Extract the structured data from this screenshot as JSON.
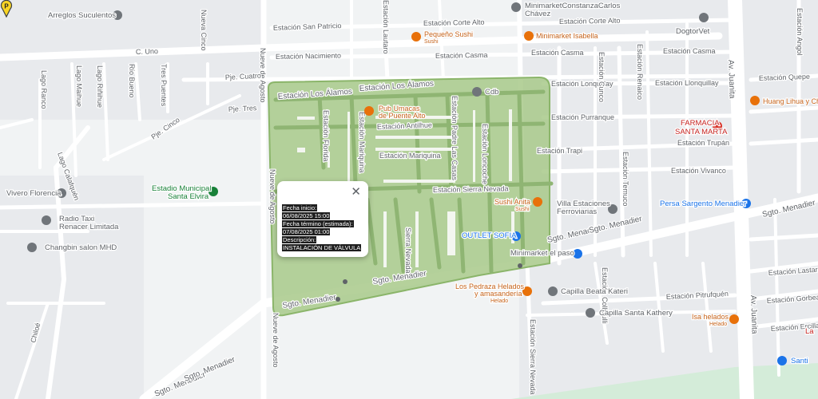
{
  "popup": {
    "fecha_inicio_label": "Fecha inicio:",
    "fecha_inicio_value": "06/08/2025 15:00",
    "fecha_termino_label": "Fecha término (estimada):",
    "fecha_termino_value": "07/08/2025 01:00",
    "descripcion_label": "Descripción:",
    "descripcion_value": "INSTALACIÓN DE VÁLVULA",
    "close_symbol": "✕"
  },
  "marker": {
    "letter": "P",
    "color": "#f9d423"
  },
  "area": {
    "fill": "#a8c98a",
    "stroke": "#8bb56a"
  },
  "streets": {
    "corte_alto_1": "Estación Corte Alto",
    "corte_alto_2": "Estación Corte Alto",
    "san_patricio": "Estación San Patricio",
    "c_uno": "C. Uno",
    "nacimiento": "Estación Nacimiento",
    "casma_1": "Estación Casma",
    "casma_2": "Estación Casma",
    "casma_3": "Estación Casma",
    "los_alamos_1": "Estación Los Álamos",
    "los_alamos_2": "Estación Los Álamos",
    "lonquillay_1": "Estación Lonquillay",
    "lonquillay_2": "Estación Llonquillay",
    "quepe": "Estación Quepe",
    "purranque": "Estación Purranque",
    "antilhue": "Estación Antilhue",
    "trapi": "Estación Trapi",
    "trupan": "Estación Trupán",
    "vivanco": "Estación Vivanco",
    "mariquina": "Estación Mariquina",
    "sierra_nevada": "Estación Sierra Nevada",
    "sgto_menadier_1": "Sgto. Menadier",
    "sgto_menadier_2": "Sgto. Menadier",
    "sgto_menadier_3": "Sgto. Menadier",
    "sgto_menadier_4": "Sgto. Menadier",
    "sgto_menadier_5": "Sgto. Menadier",
    "sgto_menadier_6": "Sgto. Menadier",
    "sgto_menadier_7": "Sgto. Menadier",
    "pitrufquen": "Estación Pitrufquén",
    "gorbea": "Estación Gorbea",
    "lastarria": "Estación Lastarria",
    "ercilla": "Estación Ercilla",
    "av_juanita_1": "Av. Juanita",
    "av_juanita_2": "Av. Juanita",
    "nueve_agosto_1": "Nueve de Agosto",
    "nueve_agosto_2": "Nueve de Agosto",
    "nueve_agosto_3": "Nueve de Agosto",
    "chiloe": "Chiloé",
    "pje_cuatro": "Pje. Cuatro",
    "pje_tres": "Pje. Tres",
    "pje_cinco": "Pje. Cinco",
    "lago_ranco": "Lago Ranco",
    "lago_maihue": "Lago Maihue",
    "lago_riñihue": "Lago Riñihue",
    "rio_bueno": "Río Bueno",
    "tres_puentes": "Tres Puentes",
    "el_parque": "Nueva Cinco",
    "lago_calafquen": "Lago Calafquén",
    "estacion_florida": "Estación Florida",
    "estacion_mariquina_v": "Estación Mariquina",
    "estacion_lautaro": "Estación Lautaro",
    "estacion_padre_c": "Estación Padre Las Casas",
    "estacion_loncoche": "Estación Loncoche",
    "estacion_cunco": "Estación Cunco",
    "estacion_temuco": "Estación Temuco",
    "sierra_nevada_v": "Estación Sierra Nevada",
    "alto_nevada": "Sierra Nevada",
    "estacion_renaico": "Estación Renaico",
    "estacion_collipulli": "Estación Collipulli",
    "estacion_angol": "Estación Angol"
  },
  "pois": {
    "arreglos": "Arreglos Suculentos",
    "minimarket_constanza_1": "MinimarketConstanzaCarlos",
    "minimarket_constanza_2": "Chávez",
    "pequeno_sushi": "Pequeño Sushi",
    "pequeno_sushi_sub": "Sushi",
    "minimarket_isabella": "Minimarket Isabella",
    "dogtorvet": "DogtorVet",
    "huang_lihua": "Huang Lihua y Cheng",
    "farmacia_1": "FARMACIA",
    "farmacia_2": "SANTA MARTA",
    "pub_1": "Pub Umacas",
    "pub_2": "de Puente Alto",
    "cdb": "Cdb",
    "estadio_1": "Estadio Municipal",
    "estadio_2": "Santa Elvira",
    "vivero": "Vivero Florencia",
    "radio_1": "Radio Taxi",
    "radio_2": "Renacer Limitada",
    "changbin": "Changbin salon MHD",
    "sushi_anita": "Sushi Anita",
    "sushi_anita_sub": "Sushi",
    "villa_1": "Villa Estaciones",
    "villa_2": "Ferroviarias",
    "persa": "Persa Sargento Menadier",
    "outlet": "OUTLET SOFIA",
    "minimarket_paso": "Minimarket el paso",
    "pedraza_1": "Los Pedraza Helados",
    "pedraza_2": "y amasandería",
    "pedraza_sub": "Helado",
    "capilla_katari": "Capilla Beata Kateri",
    "capilla_kathery": "Capilla Santa Kathery",
    "isa_helados": "Isa helados",
    "isa_helados_sub": "Helado",
    "santi": "Santi",
    "la": "La"
  },
  "colors": {
    "water_bg": "#f1f3f4",
    "road_white": "#ffffff",
    "road_major": "#dadce0",
    "park": "#d4ecd9",
    "poi_orange": "#e8710a",
    "poi_gray": "#70757a",
    "poi_blue": "#1a73e8",
    "poi_green": "#188038",
    "poi_red": "#d93025"
  }
}
